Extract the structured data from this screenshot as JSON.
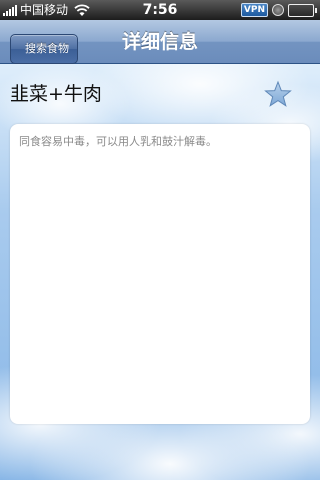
{
  "status_bar": {
    "carrier": "中国移动",
    "time": "7:56",
    "vpn_label": "VPN",
    "battery_level": 1.0,
    "icons": [
      "signal-icon",
      "wifi-icon",
      "lock-icon",
      "battery-icon"
    ]
  },
  "nav": {
    "back_label": "搜索食物",
    "title": "详细信息"
  },
  "detail": {
    "food_name": "韭菜+牛肉",
    "favorite_icon": "star-icon",
    "description": "同食容易中毒，可以用人乳和鼓汁解毒。"
  },
  "colors": {
    "nav_bar": "#7394c1",
    "back_button": "#4a6ea5",
    "star": "#8fb5dd",
    "card": "#ffffff",
    "description_text": "#8a8a8a"
  }
}
